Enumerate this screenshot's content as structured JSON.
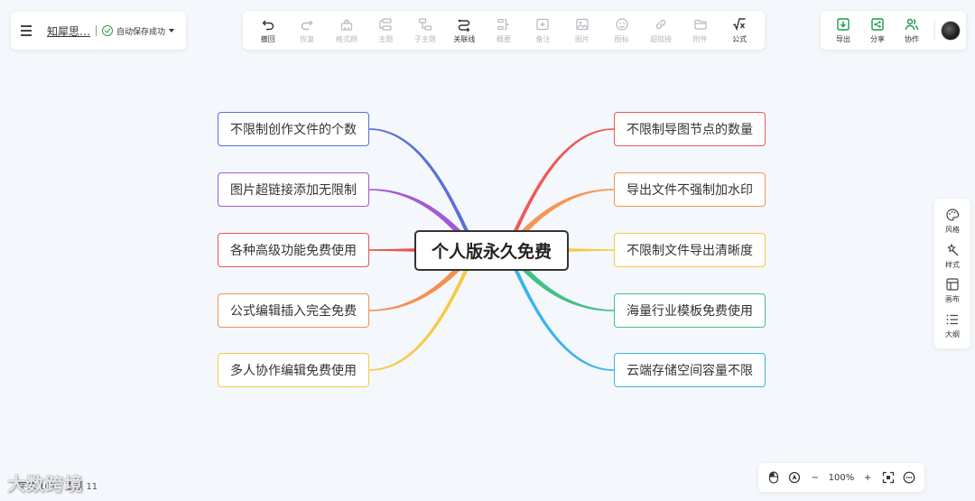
{
  "header": {
    "title": "知犀思…",
    "save_status": "自动保存成功"
  },
  "toolbar": [
    {
      "label": "撤回",
      "icon": "undo-icon",
      "enabled": true
    },
    {
      "label": "恢复",
      "icon": "redo-icon",
      "enabled": false
    },
    {
      "label": "格式刷",
      "icon": "format-brush-icon",
      "enabled": false
    },
    {
      "label": "主题",
      "icon": "topic-icon",
      "enabled": false
    },
    {
      "label": "子主题",
      "icon": "subtopic-icon",
      "enabled": false
    },
    {
      "label": "关联线",
      "icon": "relation-line-icon",
      "enabled": true
    },
    {
      "label": "概要",
      "icon": "summary-icon",
      "enabled": false
    },
    {
      "label": "备注",
      "icon": "note-icon",
      "enabled": false
    },
    {
      "label": "图片",
      "icon": "image-icon",
      "enabled": false
    },
    {
      "label": "图标",
      "icon": "emoji-icon",
      "enabled": false
    },
    {
      "label": "超链接",
      "icon": "link-icon",
      "enabled": false
    },
    {
      "label": "附件",
      "icon": "attachment-icon",
      "enabled": false
    },
    {
      "label": "公式",
      "icon": "formula-icon",
      "enabled": true
    }
  ],
  "topright": {
    "export_label": "导出",
    "share_label": "分享",
    "collab_label": "协作"
  },
  "dock": {
    "style_label": "风格",
    "format_label": "样式",
    "canvas_label": "画布",
    "outline_label": "大纲"
  },
  "zoom": {
    "level": "100%",
    "minus": "−",
    "plus": "+"
  },
  "stats": {
    "words": "字数 107",
    "topics": "主题 11"
  },
  "watermark": "大数跨境",
  "mindmap": {
    "center": "个人版永久免费",
    "left": [
      {
        "label": "不限制创作文件的个数",
        "color": "#5b6fd6"
      },
      {
        "label": "图片超链接添加无限制",
        "color": "#a259d4"
      },
      {
        "label": "各种高级功能免费使用",
        "color": "#e8554f"
      },
      {
        "label": "公式编辑插入完全免费",
        "color": "#f39052"
      },
      {
        "label": "多人协作编辑免费使用",
        "color": "#f6ca43"
      }
    ],
    "right": [
      {
        "label": "不限制导图节点的数量",
        "color": "#ec5a57"
      },
      {
        "label": "导出文件不强制加水印",
        "color": "#f59653"
      },
      {
        "label": "不限制文件导出清晰度",
        "color": "#f6ca43"
      },
      {
        "label": "海量行业模板免费使用",
        "color": "#43c183"
      },
      {
        "label": "云端存储空间容量不限",
        "color": "#3cb2ee"
      }
    ]
  }
}
